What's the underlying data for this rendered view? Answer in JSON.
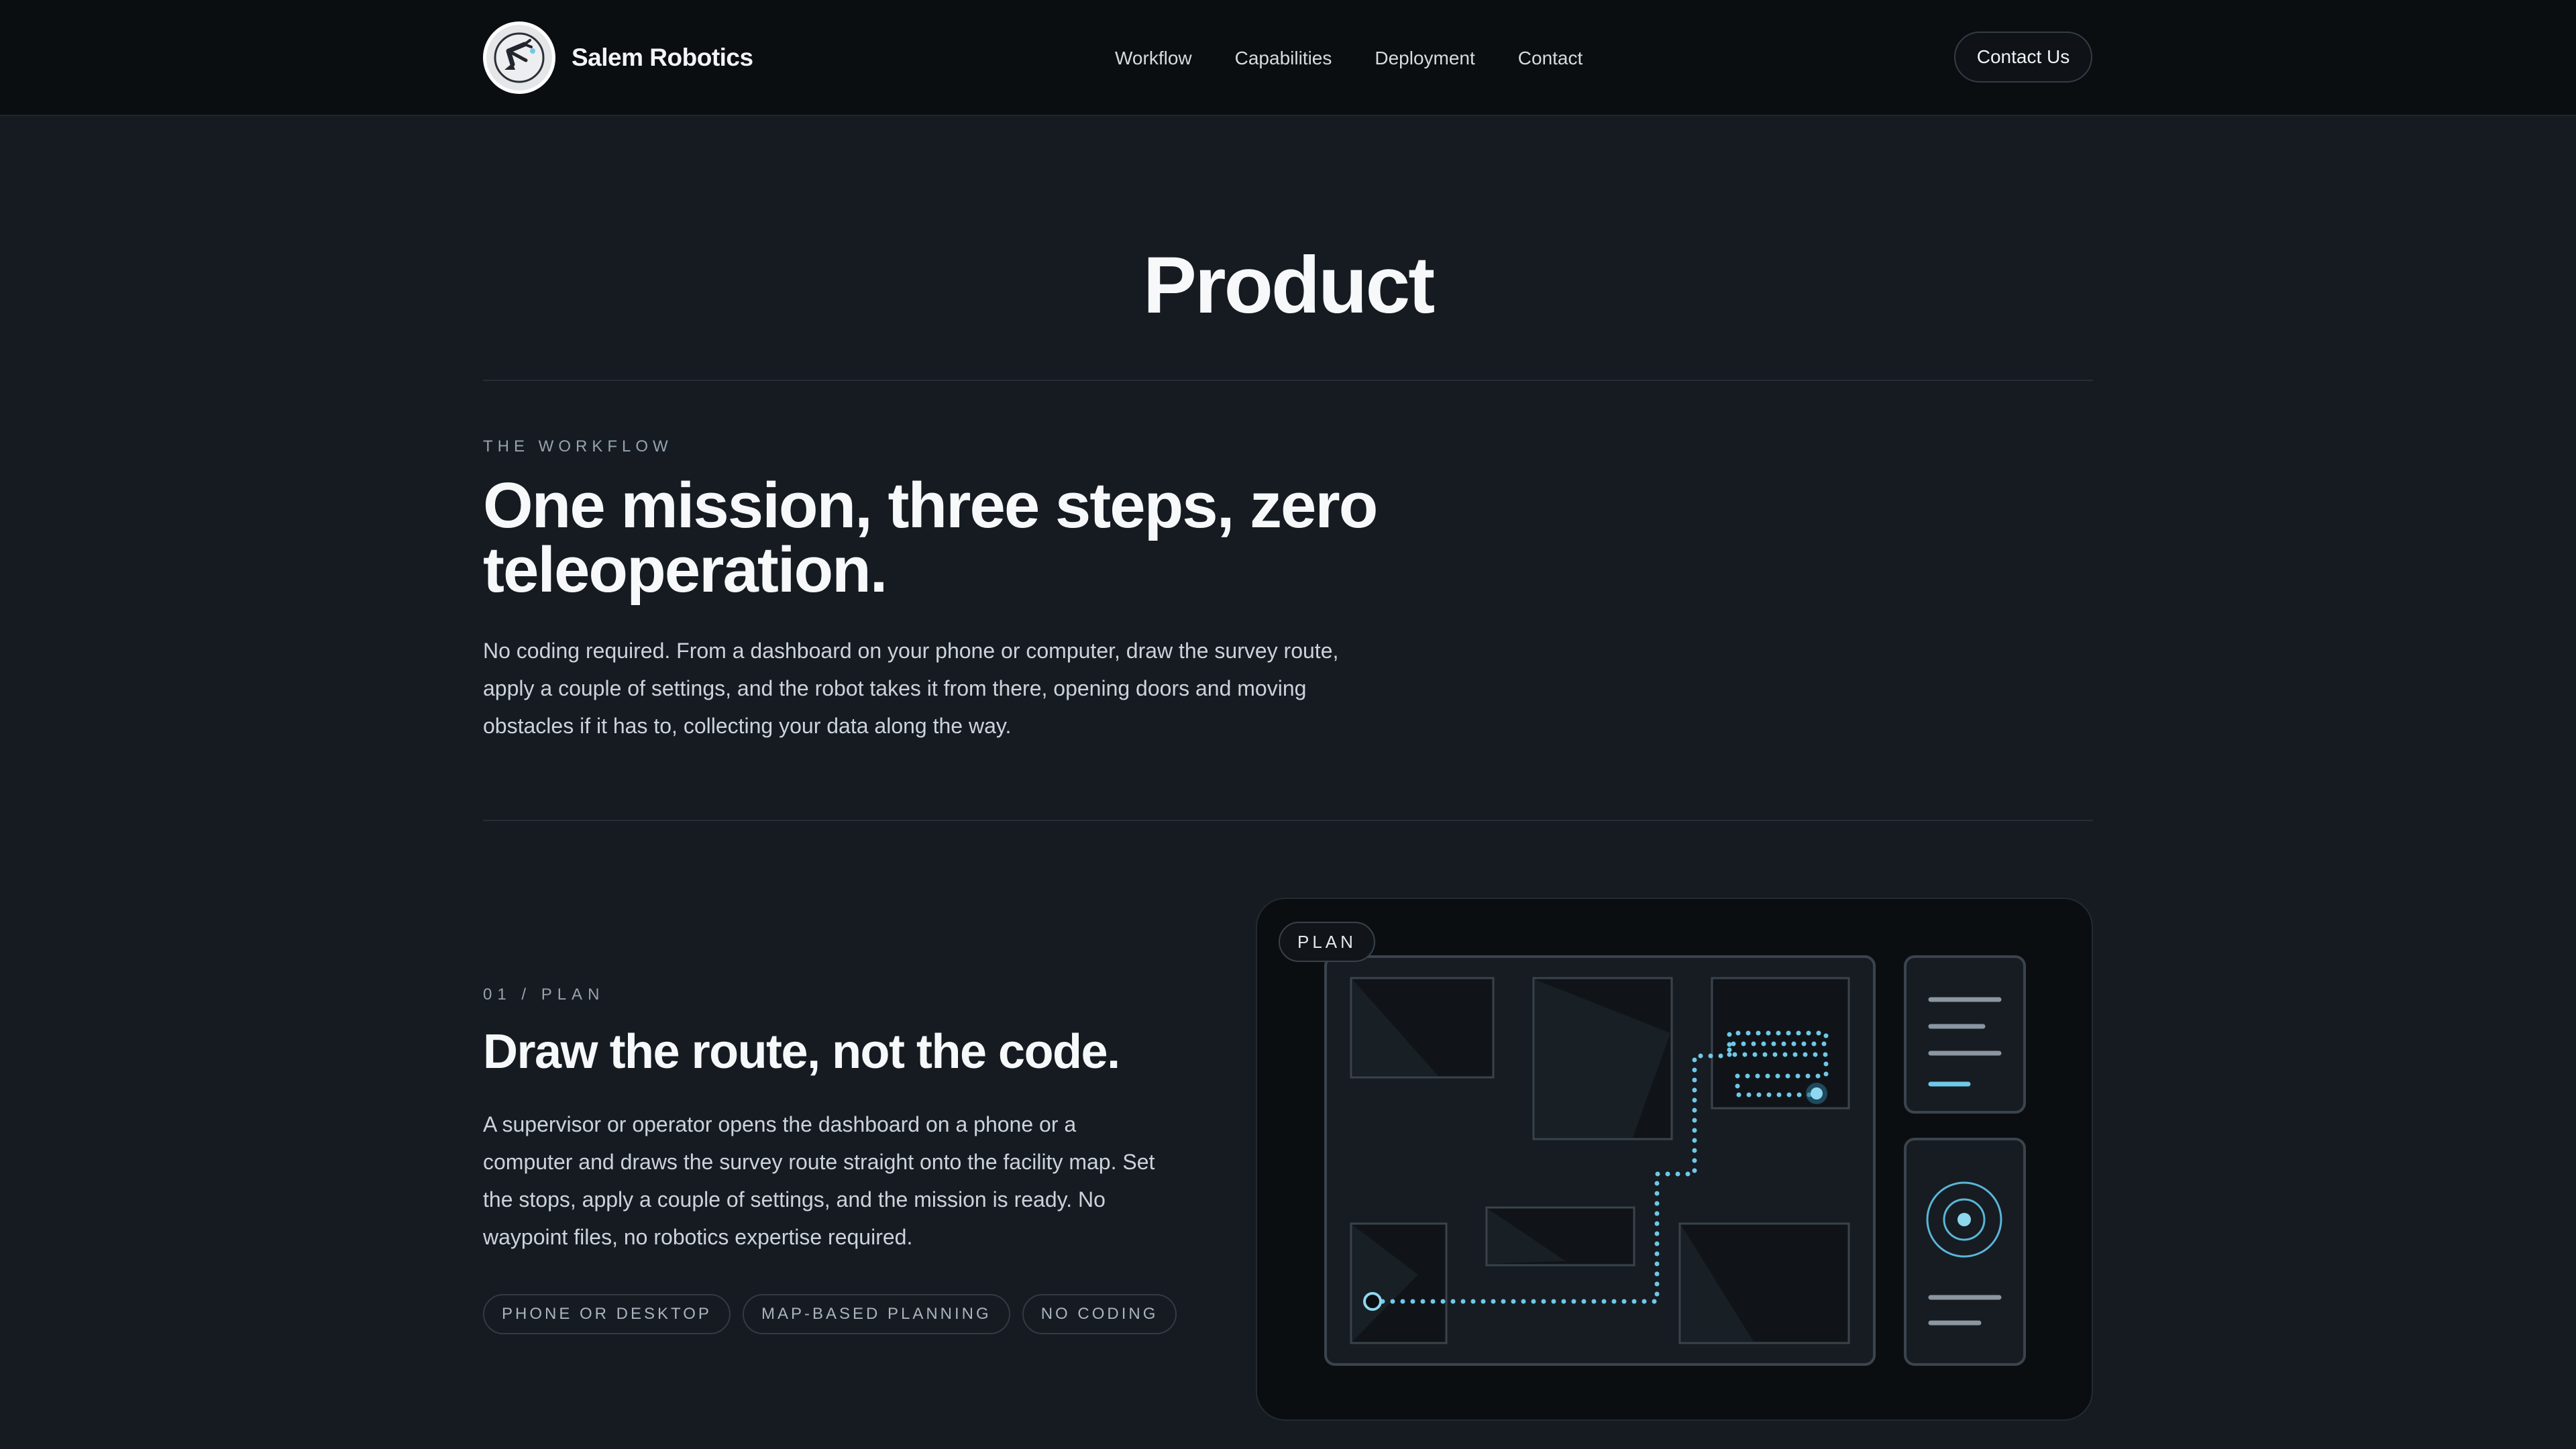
{
  "header": {
    "brand": "Salem Robotics",
    "nav": [
      "Workflow",
      "Capabilities",
      "Deployment",
      "Contact"
    ],
    "cta": "Contact Us"
  },
  "hero": {
    "title": "Product"
  },
  "workflow": {
    "eyebrow": "THE WORKFLOW",
    "heading": "One mission, three steps, zero teleoperation.",
    "body": "No coding required. From a dashboard on your phone or computer, draw the survey route, apply a couple of settings, and the robot takes it from there, opening doors and moving obstacles if it has to, collecting your data along the way."
  },
  "step1": {
    "eyebrow": "01 / PLAN",
    "heading": "Draw the route, not the code.",
    "body": "A supervisor or operator opens the dashboard on a phone or a computer and draws the survey route straight onto the facility map. Set the stops, apply a couple of settings, and the mission is ready. No waypoint files, no robotics expertise required.",
    "tags": [
      "PHONE OR DESKTOP",
      "MAP-BASED PLANNING",
      "NO CODING"
    ],
    "illustration": {
      "badge": "PLAN",
      "icons": [
        "robot-arm-logo-icon",
        "route-path-icon",
        "target-icon",
        "menu-lines-icon"
      ],
      "accent_color": "#6fc8e8"
    }
  }
}
